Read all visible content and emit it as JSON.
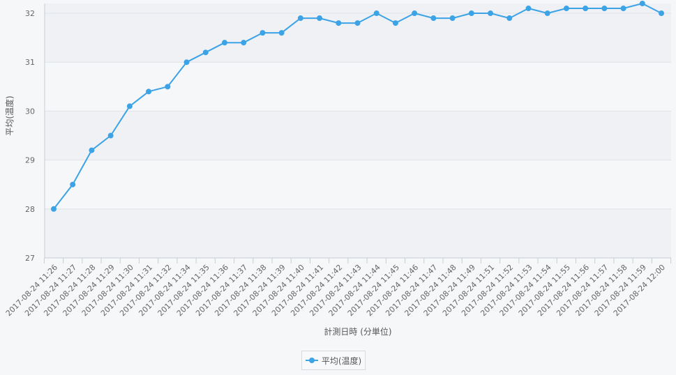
{
  "chart_data": {
    "type": "line",
    "xlabel": "計測日時 (分単位)",
    "ylabel": "平均(温度)",
    "ylim": [
      27,
      32.2
    ],
    "yticks": [
      27,
      28,
      29,
      30,
      31,
      32
    ],
    "grid": true,
    "legend_position": "bottom-center",
    "categories": [
      "2017-08-24 11:26",
      "2017-08-24 11:27",
      "2017-08-24 11:28",
      "2017-08-24 11:29",
      "2017-08-24 11:30",
      "2017-08-24 11:31",
      "2017-08-24 11:32",
      "2017-08-24 11:34",
      "2017-08-24 11:35",
      "2017-08-24 11:36",
      "2017-08-24 11:37",
      "2017-08-24 11:38",
      "2017-08-24 11:39",
      "2017-08-24 11:40",
      "2017-08-24 11:41",
      "2017-08-24 11:42",
      "2017-08-24 11:43",
      "2017-08-24 11:44",
      "2017-08-24 11:45",
      "2017-08-24 11:46",
      "2017-08-24 11:47",
      "2017-08-24 11:48",
      "2017-08-24 11:49",
      "2017-08-24 11:51",
      "2017-08-24 11:52",
      "2017-08-24 11:53",
      "2017-08-24 11:54",
      "2017-08-24 11:55",
      "2017-08-24 11:56",
      "2017-08-24 11:57",
      "2017-08-24 11:58",
      "2017-08-24 11:59",
      "2017-08-24 12:00"
    ],
    "series": [
      {
        "name": "平均(温度)",
        "color": "#3ca3e6",
        "values": [
          28.0,
          28.5,
          29.2,
          29.5,
          30.1,
          30.4,
          30.5,
          31.0,
          31.2,
          31.4,
          31.4,
          31.6,
          31.6,
          31.9,
          31.9,
          31.8,
          31.8,
          32.0,
          31.8,
          32.0,
          31.9,
          31.9,
          32.0,
          32.0,
          31.9,
          32.1,
          32.0,
          32.1,
          32.1,
          32.1,
          32.1,
          32.2,
          32.0
        ]
      }
    ]
  },
  "colors": {
    "band": "#eff1f4",
    "grid": "#dfe3e8",
    "axis": "#c9ced4",
    "background": "#f5f7f9"
  }
}
